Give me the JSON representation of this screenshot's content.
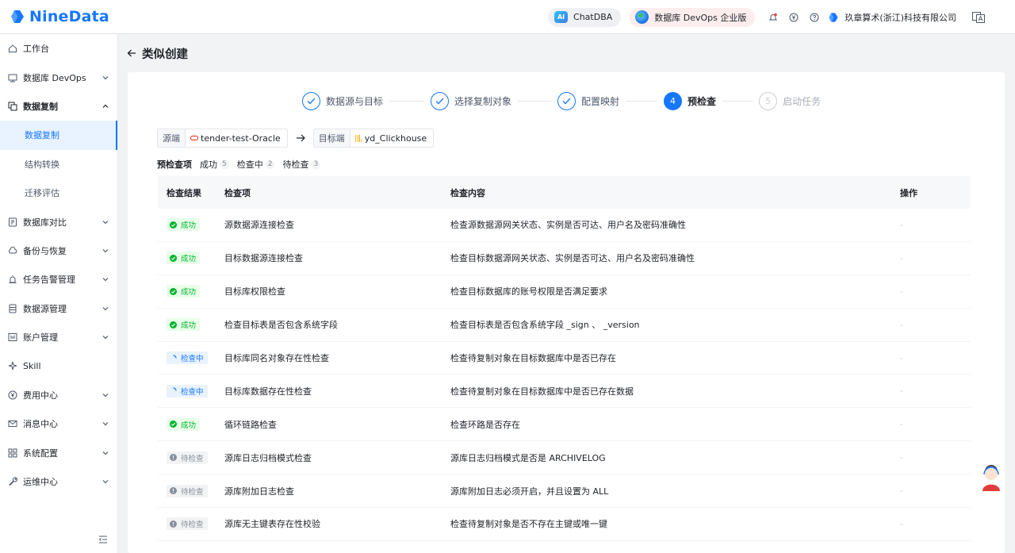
{
  "app": {
    "name": "NineData"
  },
  "header": {
    "chat_label": "ChatDBA",
    "ai_badge": "AI",
    "edition_label": "数据库 DevOps 企业版",
    "company": "玖章算术(浙江)科技有限公司"
  },
  "sidebar": {
    "items": [
      {
        "label": "工作台",
        "icon": "home-icon",
        "chevron": false
      },
      {
        "label": "数据库 DevOps",
        "icon": "monitor-icon",
        "chevron": true
      },
      {
        "label": "数据复制",
        "icon": "copy-icon",
        "chevron": true,
        "expanded": true
      },
      {
        "label": "数据库对比",
        "icon": "compare-icon",
        "chevron": true
      },
      {
        "label": "备份与恢复",
        "icon": "cloud-icon",
        "chevron": true
      },
      {
        "label": "任务告警管理",
        "icon": "alarm-icon",
        "chevron": true
      },
      {
        "label": "数据源管理",
        "icon": "database-icon",
        "chevron": true
      },
      {
        "label": "账户管理",
        "icon": "account-icon",
        "chevron": true
      },
      {
        "label": "Skill",
        "icon": "sparkle-icon",
        "chevron": false
      },
      {
        "label": "费用中心",
        "icon": "yen-icon",
        "chevron": true
      },
      {
        "label": "消息中心",
        "icon": "mail-icon",
        "chevron": true
      },
      {
        "label": "系统配置",
        "icon": "grid-icon",
        "chevron": true
      },
      {
        "label": "运维中心",
        "icon": "wrench-icon",
        "chevron": true
      }
    ],
    "sub_items": [
      {
        "label": "数据复制",
        "active": true
      },
      {
        "label": "结构转换",
        "active": false
      },
      {
        "label": "迁移评估",
        "active": false
      }
    ]
  },
  "page": {
    "title": "类似创建"
  },
  "steps": [
    {
      "label": "数据源与目标",
      "state": "done",
      "number": "1"
    },
    {
      "label": "选择复制对象",
      "state": "done",
      "number": "2"
    },
    {
      "label": "配置映射",
      "state": "done",
      "number": "3"
    },
    {
      "label": "预检查",
      "state": "current",
      "number": "4"
    },
    {
      "label": "启动任务",
      "state": "todo",
      "number": "5"
    }
  ],
  "source": {
    "label": "源端",
    "value": "tender-test-Oracle"
  },
  "target": {
    "label": "目标端",
    "value": "yd_Clickhouse"
  },
  "filters": {
    "all": {
      "label": "预检查项"
    },
    "success": {
      "label": "成功",
      "count": "5"
    },
    "checking": {
      "label": "检查中",
      "count": "2"
    },
    "pending": {
      "label": "待检查",
      "count": "3"
    }
  },
  "table": {
    "headers": {
      "result": "检查结果",
      "item": "检查项",
      "content": "检查内容",
      "action": "操作"
    },
    "rows": [
      {
        "status": "success",
        "status_label": "成功",
        "item": "源数据源连接检查",
        "content": "检查源数据源网关状态、实例是否可达、用户名及密码准确性",
        "action": "-"
      },
      {
        "status": "success",
        "status_label": "成功",
        "item": "目标数据源连接检查",
        "content": "检查目标数据源网关状态、实例是否可达、用户名及密码准确性",
        "action": "-"
      },
      {
        "status": "success",
        "status_label": "成功",
        "item": "目标库权限检查",
        "content": "检查目标数据库的账号权限是否满足要求",
        "action": "-"
      },
      {
        "status": "success",
        "status_label": "成功",
        "item": "检查目标表是否包含系统字段",
        "content": "检查目标表是否包含系统字段 _sign 、 _version",
        "action": "-"
      },
      {
        "status": "checking",
        "status_label": "检查中",
        "item": "目标库同名对象存在性检查",
        "content": "检查待复制对象在目标数据库中是否已存在",
        "action": "-"
      },
      {
        "status": "checking",
        "status_label": "检查中",
        "item": "目标库数据存在性检查",
        "content": "检查待复制对象在目标数据库中是否已存在数据",
        "action": "-"
      },
      {
        "status": "success",
        "status_label": "成功",
        "item": "循环链路检查",
        "content": "检查环路是否存在",
        "action": "-"
      },
      {
        "status": "pending",
        "status_label": "待检查",
        "item": "源库日志归档模式检查",
        "content": "源库日志归档模式是否是 ARCHIVELOG",
        "action": "-"
      },
      {
        "status": "pending",
        "status_label": "待检查",
        "item": "源库附加日志检查",
        "content": "源库附加日志必须开启，并且设置为 ALL",
        "action": "-"
      },
      {
        "status": "pending",
        "status_label": "待检查",
        "item": "源库无主键表存在性校验",
        "content": "检查待复制对象是否不存在主键或唯一键",
        "action": "-"
      }
    ]
  },
  "colors": {
    "primary": "#1677ff",
    "success": "#00b42a",
    "pending": "#86909c"
  }
}
